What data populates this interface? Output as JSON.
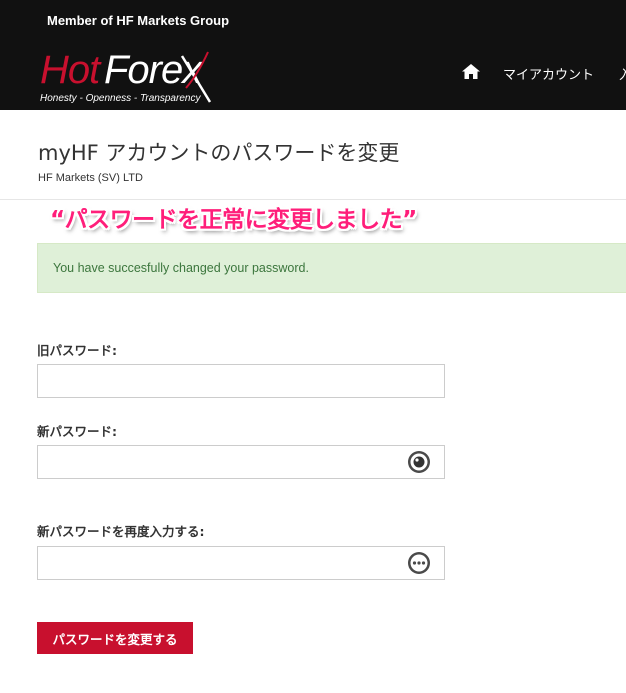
{
  "header": {
    "member_text": "Member of HF Markets Group",
    "logo": {
      "brand_hot": "Hot",
      "brand_forex": "Forex",
      "tagline": "Honesty - Openness - Transparency"
    },
    "nav": {
      "home_icon": "home-icon",
      "account_label": "マイアカウント",
      "more_label": "入"
    }
  },
  "page": {
    "title": "myHF アカウントのパスワードを変更",
    "subtitle": "HF Markets (SV) LTD"
  },
  "annotation": "“パスワードを正常に変更しました”",
  "alert": {
    "message": "You have succesfully changed your password."
  },
  "form": {
    "old_password": {
      "label": "旧パスワード:",
      "value": ""
    },
    "new_password": {
      "label": "新パスワード:",
      "value": "",
      "toggle_icon": "eye-icon"
    },
    "confirm_password": {
      "label": "新パスワードを再度入力する:",
      "value": "",
      "toggle_icon": "eye-hidden-icon"
    },
    "submit_label": "パスワードを変更する"
  },
  "colors": {
    "brand_red": "#c8102e",
    "header_bg": "#111111",
    "success_bg": "#dff0d8",
    "success_text": "#3c763d",
    "annotation_pink": "#ff1e7a"
  }
}
